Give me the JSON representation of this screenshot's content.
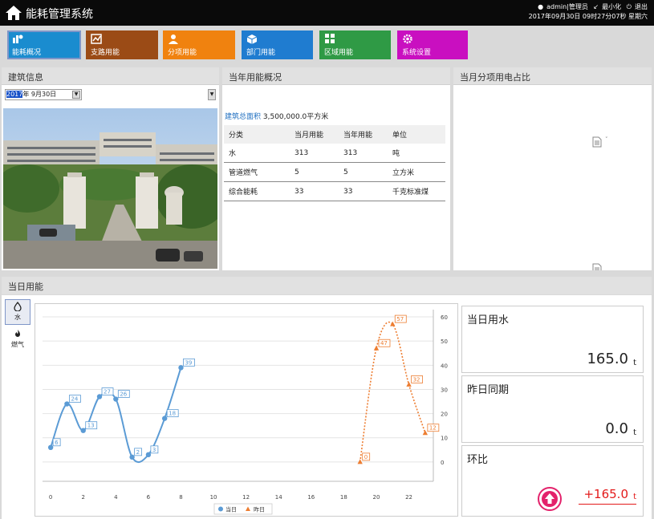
{
  "app": {
    "title": "能耗管理系统",
    "user": "admin|管理员",
    "minimize": "最小化",
    "logout": "退出",
    "datetime": "2017年09月30日 09时27分07秒 星期六"
  },
  "nav": {
    "items": [
      {
        "label": "能耗概况",
        "color": "#1a8ccf"
      },
      {
        "label": "支路用能",
        "color": "#9b4b16"
      },
      {
        "label": "分项用能",
        "color": "#f0820f"
      },
      {
        "label": "部门用能",
        "color": "#1f7cd0"
      },
      {
        "label": "区域用能",
        "color": "#2f9a45"
      },
      {
        "label": "系统设置",
        "color": "#c90fc0"
      }
    ]
  },
  "building": {
    "title": "建筑信息",
    "date_year": "2017",
    "date_rest": "年 9月30日"
  },
  "summary": {
    "title": "当年用能概况",
    "area_label": "建筑总面积",
    "area_value": "3,500,000.0平方米",
    "headers": [
      "分类",
      "当月用能",
      "当年用能",
      "单位"
    ],
    "rows": [
      [
        "水",
        "313",
        "313",
        "吨"
      ],
      [
        "管道燃气",
        "5",
        "5",
        "立方米"
      ],
      [
        "综合能耗",
        "33",
        "33",
        "千克标准煤"
      ]
    ]
  },
  "ratio": {
    "title": "当月分项用电占比"
  },
  "daily": {
    "title": "当日用能",
    "tabs": [
      {
        "label": "水"
      },
      {
        "label": "燃气"
      }
    ],
    "metrics": {
      "today_label": "当日用水",
      "today_value": "165.0",
      "today_unit": "t",
      "yesterday_label": "昨日同期",
      "yesterday_value": "0.0",
      "yesterday_unit": "t",
      "ratio_label": "环比",
      "ratio_value": "+165.0",
      "ratio_unit": "t"
    }
  },
  "chart_data": {
    "type": "line",
    "x_ticks": [
      0,
      2,
      4,
      6,
      8,
      10,
      12,
      14,
      16,
      18,
      20,
      22
    ],
    "y_ticks": [
      0,
      10,
      20,
      30,
      40,
      50,
      60
    ],
    "xlim": [
      -0.5,
      23.5
    ],
    "ylim": [
      -8,
      63
    ],
    "grid": true,
    "legend_position": "bottom",
    "series": [
      {
        "name": "当日",
        "color": "#5b9bd5",
        "marker": "circle",
        "x": [
          0,
          1,
          2,
          3,
          4,
          5,
          6,
          7,
          8
        ],
        "y": [
          6,
          24,
          13,
          27,
          26,
          2,
          3,
          18,
          39
        ]
      },
      {
        "name": "昨日",
        "color": "#ed7d31",
        "marker": "triangle",
        "x": [
          19,
          20,
          21,
          22,
          23
        ],
        "y": [
          0,
          47,
          57,
          32,
          12
        ]
      }
    ]
  }
}
